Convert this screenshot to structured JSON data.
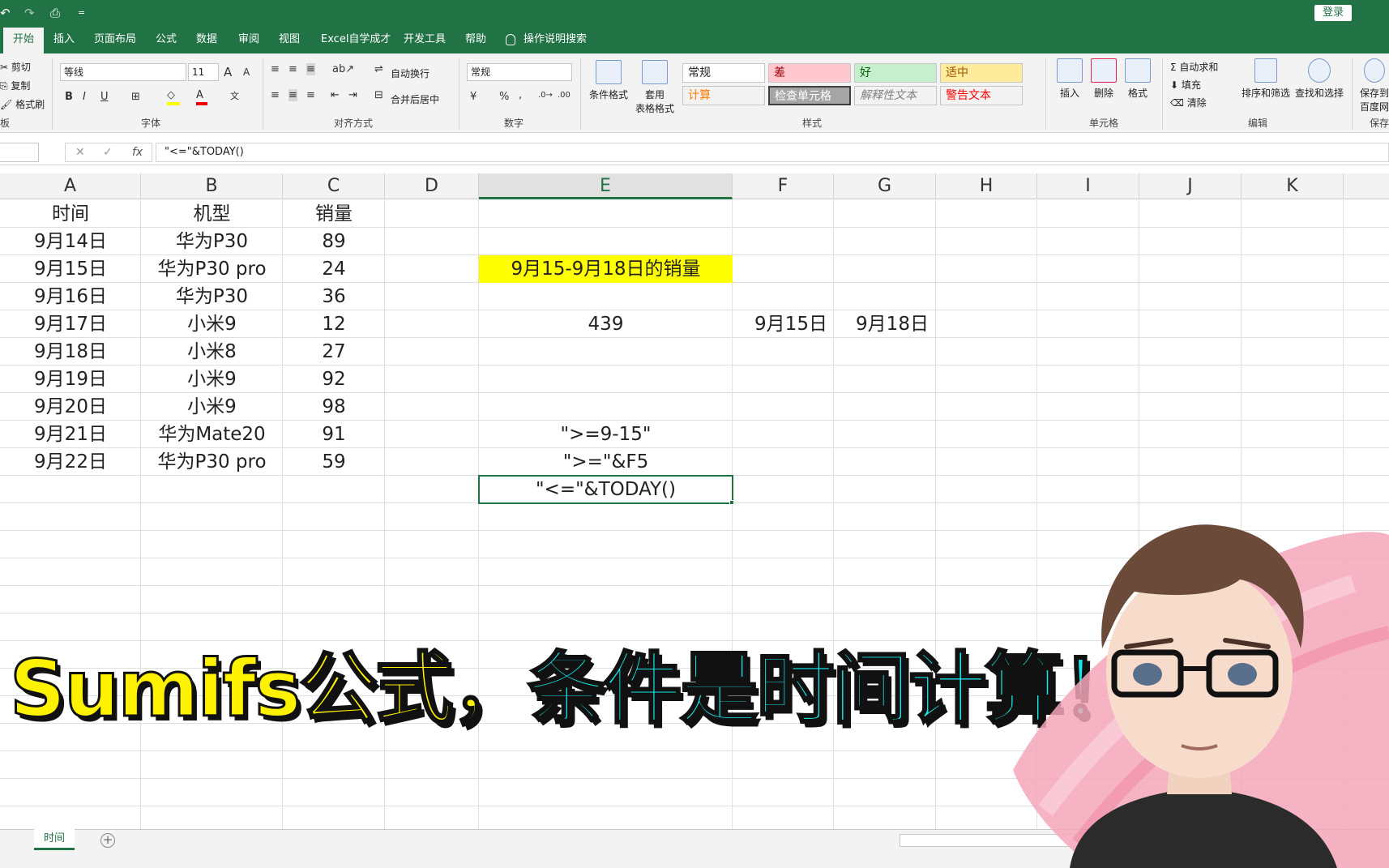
{
  "qat": {
    "undo": "↶",
    "redo": "↷",
    "preview": "⎙",
    "more": "="
  },
  "login": "登录",
  "tabs": [
    "开始",
    "插入",
    "页面布局",
    "公式",
    "数据",
    "审阅",
    "视图",
    "Excel自学成才",
    "开发工具",
    "帮助"
  ],
  "tell_me": "操作说明搜索",
  "ribbon": {
    "clipboard": {
      "cut": "剪切",
      "copy": "复制",
      "painter": "格式刷",
      "label": "板"
    },
    "font": {
      "family": "等线",
      "size": "11",
      "label": "字体",
      "grow": "A",
      "shrink": "A",
      "bold": "B",
      "italic": "I",
      "underline": "U"
    },
    "align": {
      "wrap": "自动换行",
      "merge": "合并后居中",
      "label": "对齐方式"
    },
    "number": {
      "format": "常规",
      "percent": "%",
      "comma": ",",
      "label": "数字"
    },
    "styles": {
      "cond": "条件格式",
      "table_l1": "套用",
      "table_l2": "表格格式",
      "cells": [
        {
          "text": "常规",
          "bg": "#ffffff",
          "fg": "#222222"
        },
        {
          "text": "差",
          "bg": "#ffc7ce",
          "fg": "#9c0006"
        },
        {
          "text": "好",
          "bg": "#c6efce",
          "fg": "#006100"
        },
        {
          "text": "适中",
          "bg": "#ffeb9c",
          "fg": "#9c5700"
        },
        {
          "text": "计算",
          "bg": "#f2f2f2",
          "fg": "#fa7d00"
        },
        {
          "text": "检查单元格",
          "bg": "#a5a5a5",
          "fg": "#ffffff"
        },
        {
          "text": "解释性文本",
          "bg": "#f3f3f3",
          "fg": "#7f7f7f"
        },
        {
          "text": "警告文本",
          "bg": "#f3f3f3",
          "fg": "#ff0000"
        }
      ],
      "label": "样式"
    },
    "cells": {
      "insert": "插入",
      "delete": "删除",
      "format": "格式",
      "label": "单元格"
    },
    "edit": {
      "autosum": "自动求和",
      "fill": "填充",
      "clear": "清除",
      "sort": "排序和筛选",
      "find": "查找和选择",
      "label": "编辑"
    },
    "save": {
      "l1": "保存到",
      "l2": "百度网",
      "label": "保存"
    }
  },
  "formula_bar": {
    "fx": "fx",
    "cancel": "✕",
    "enter": "✓",
    "formula": "\"<=\"&TODAY()"
  },
  "columns": [
    "A",
    "B",
    "C",
    "D",
    "E",
    "F",
    "G",
    "H",
    "I",
    "J",
    "K"
  ],
  "selected_column": "E",
  "table": {
    "headers": [
      "时间",
      "机型",
      "销量"
    ],
    "rows": [
      [
        "9月14日",
        "华为P30",
        "89"
      ],
      [
        "9月15日",
        "华为P30 pro",
        "24"
      ],
      [
        "9月16日",
        "华为P30",
        "36"
      ],
      [
        "9月17日",
        "小米9",
        "12"
      ],
      [
        "9月18日",
        "小米8",
        "27"
      ],
      [
        "9月19日",
        "小米9",
        "92"
      ],
      [
        "9月20日",
        "小米9",
        "98"
      ],
      [
        "9月21日",
        "华为Mate20",
        "91"
      ],
      [
        "9月22日",
        "华为P30 pro",
        "59"
      ]
    ]
  },
  "cells_e": {
    "e3": "9月15-9月18日的销量",
    "e5": "439",
    "f5": "9月15日",
    "g5": "9月18日",
    "e9": "\">=9-15\"",
    "e10": "\">=\"&F5",
    "e11": "\"<=\"&TODAY()"
  },
  "highlight_color": "#ffff00",
  "sheet": {
    "name": "时间",
    "add": "+"
  },
  "caption": {
    "part1": "Sumifs公式，",
    "part2": "条件是时间计算！",
    "color1": "#fff200",
    "color2": "#14e8ea"
  },
  "accent": "#217346"
}
